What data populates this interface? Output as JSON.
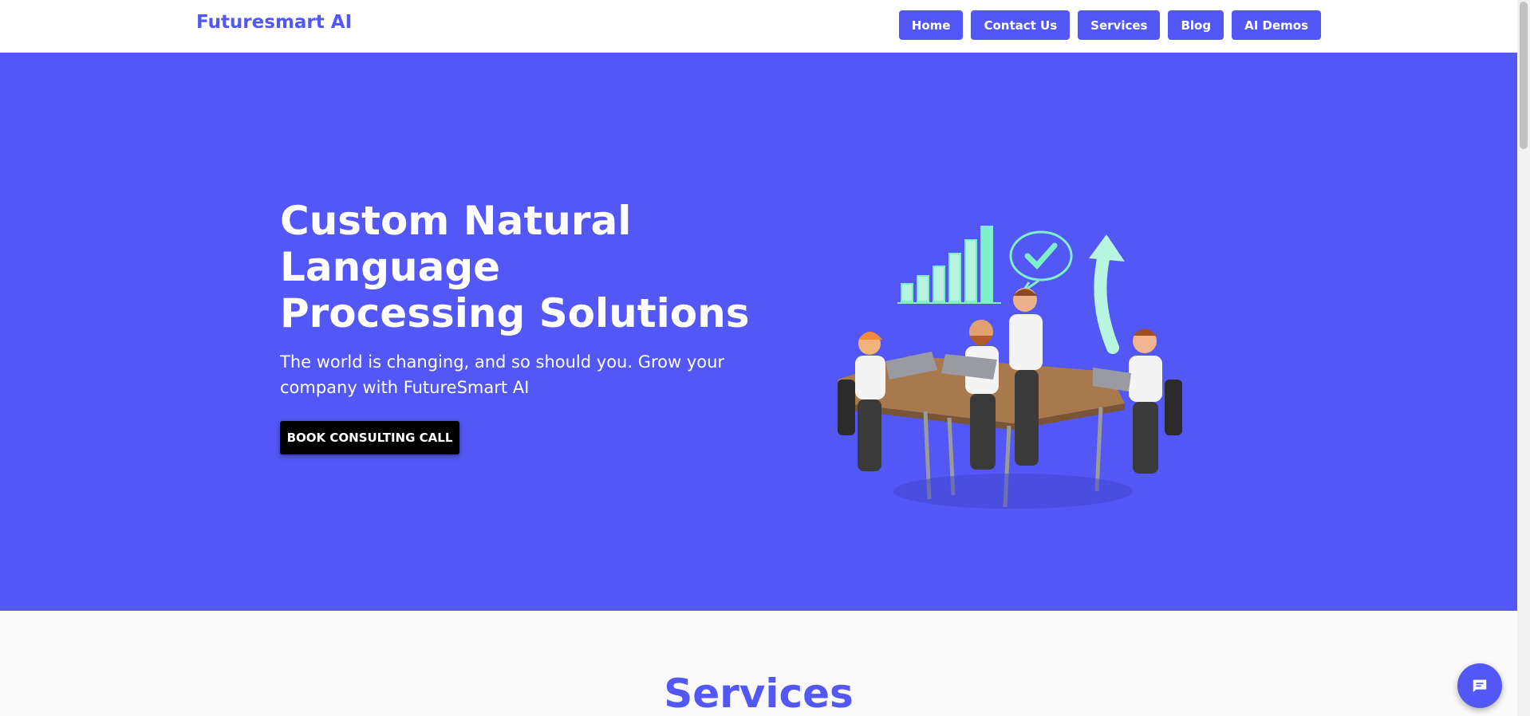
{
  "header": {
    "brand": "Futuresmart AI",
    "nav": [
      "Home",
      "Contact Us",
      "Services",
      "Blog",
      "AI Demos"
    ]
  },
  "hero": {
    "title": "Custom Natural Language Processing Solutions",
    "subtitle": "The world is changing, and so should you. Grow your company with FutureSmart AI",
    "cta_label": "BOOK CONSULTING CALL",
    "illustration": "team-meeting-illustration"
  },
  "services": {
    "heading": "Services"
  },
  "chat": {
    "icon": "chat-icon"
  },
  "colors": {
    "brand": "#5257f5",
    "accent": "#7ef0c9",
    "cta": "#000000"
  }
}
